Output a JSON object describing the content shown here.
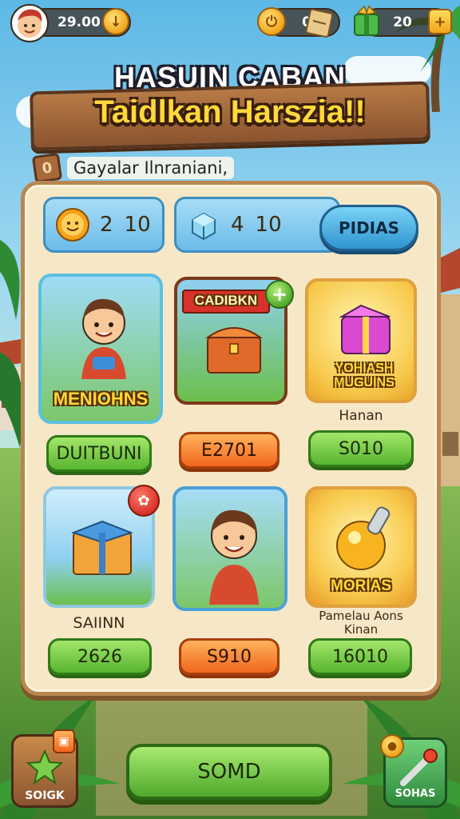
{
  "topbar": {
    "player_coins": "29.00",
    "energy_value": "0",
    "gems_value": "20"
  },
  "title": {
    "line1": "HASUIN CABAN",
    "line2": "Taidlkan Harszia!!",
    "subtitle": "Gayalar Ilnraniani,"
  },
  "resources": {
    "bar1_value_a": "2",
    "bar1_value_b": "10",
    "bar2_value_a": "4",
    "bar2_value_b": "10",
    "tab_label": "PIDIAS"
  },
  "shop_items": [
    {
      "label": "MENIOHNS",
      "caption": "",
      "price": "DUITBUNI",
      "price_style": "green"
    },
    {
      "label": "CADIBKN",
      "caption": "",
      "price": "E2701",
      "price_style": "orange"
    },
    {
      "label": "YOHIASH MUGUINS",
      "caption": "Hanan",
      "price": "S010",
      "price_style": "green"
    },
    {
      "label": "",
      "caption": "SAIINN",
      "price": "2626",
      "price_style": "green"
    },
    {
      "label": "",
      "caption": "",
      "price": "S910",
      "price_style": "orange"
    },
    {
      "label": "MORIAS",
      "caption": "Pamelau Aons Kinan",
      "price": "16010",
      "price_style": "green"
    }
  ],
  "bottom": {
    "left_label": "SOIGK",
    "main_label": "SOMD",
    "right_label": "SOHAS"
  },
  "colors": {
    "accent_green": "#58b530",
    "accent_orange": "#f0661d",
    "title_yellow": "#ffd83a",
    "panel": "#f6e7c6"
  }
}
